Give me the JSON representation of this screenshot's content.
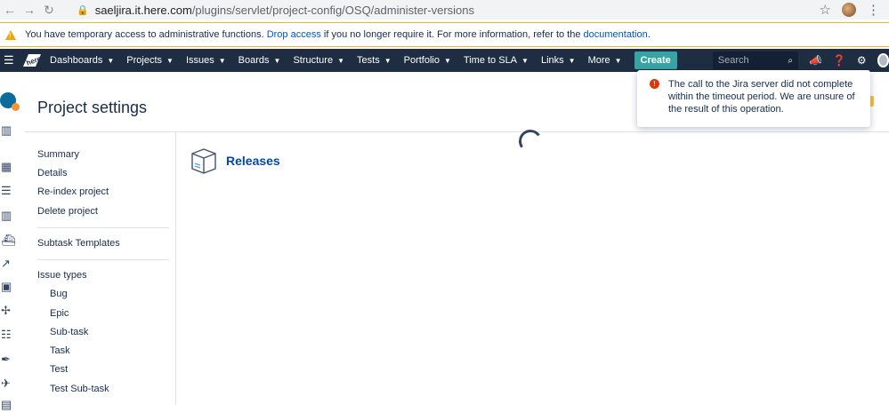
{
  "browser": {
    "url_host": "saeljira.it.here.com",
    "url_path": "/plugins/servlet/project-config/OSQ/administer-versions"
  },
  "banner": {
    "text_before": "You have temporary access to administrative functions.",
    "link_drop": "Drop access",
    "text_middle": "if you no longer require it. For more information, refer to the",
    "link_docs": "documentation",
    "text_after": "."
  },
  "nav": {
    "logo_text": "here",
    "items": [
      {
        "label": "Dashboards"
      },
      {
        "label": "Projects"
      },
      {
        "label": "Issues"
      },
      {
        "label": "Boards"
      },
      {
        "label": "Structure"
      },
      {
        "label": "Tests"
      },
      {
        "label": "Portfolio"
      },
      {
        "label": "Time to SLA"
      },
      {
        "label": "Links"
      },
      {
        "label": "More"
      }
    ],
    "create_label": "Create",
    "search_placeholder": "Search"
  },
  "page": {
    "title": "Project settings"
  },
  "sidebar": {
    "summary": "Summary",
    "details": "Details",
    "reindex": "Re-index project",
    "delete": "Delete project",
    "subtask_templates": "Subtask Templates",
    "issue_types": "Issue types",
    "types": [
      "Bug",
      "Epic",
      "Sub-task",
      "Task",
      "Test",
      "Test Sub-task"
    ]
  },
  "main": {
    "releases_title": "Releases"
  },
  "flag": {
    "message": "The call to the Jira server did not complete within the timeout period. We are unsure of the result of this operation."
  }
}
